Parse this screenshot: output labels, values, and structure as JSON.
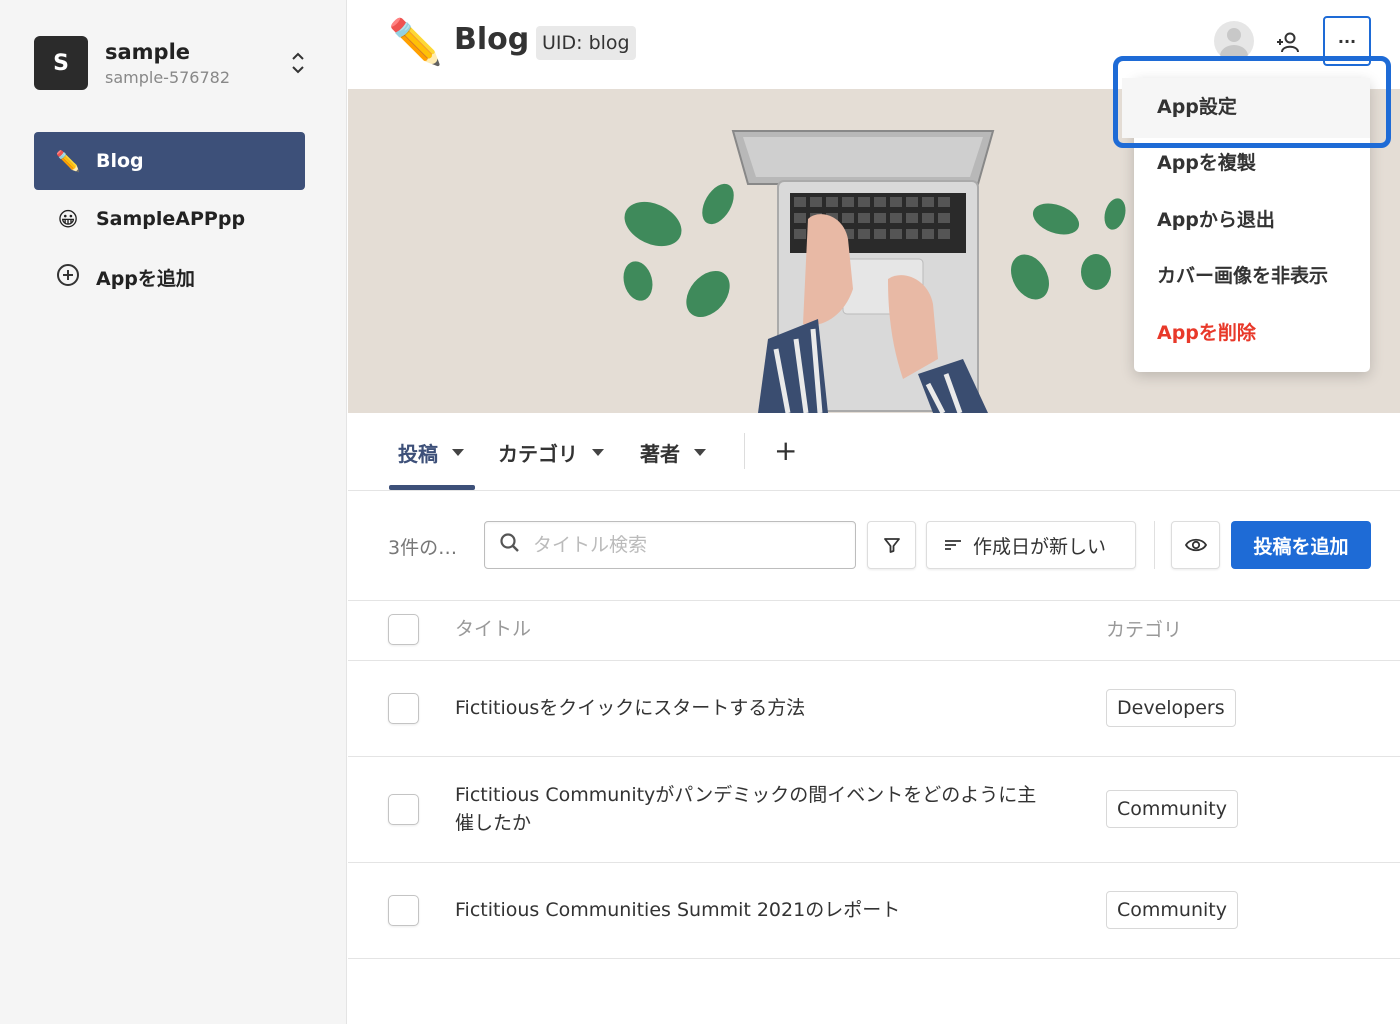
{
  "workspace": {
    "initial": "S",
    "name": "sample",
    "id": "sample-576782"
  },
  "sidebar": {
    "items": [
      {
        "icon": "✏️",
        "label": "Blog",
        "active": true
      },
      {
        "icon": "😀",
        "label": "SampleAPPpp",
        "active": false
      },
      {
        "icon": "plus-circle-icon",
        "label": "Appを追加",
        "active": false
      }
    ]
  },
  "header": {
    "icon": "✏️",
    "title": "Blog",
    "uid": "UID: blog",
    "more": "···"
  },
  "tabs": {
    "items": [
      "投稿",
      "カテゴリ",
      "著者"
    ],
    "add": "+"
  },
  "toolbar": {
    "count": "3件の…",
    "search_placeholder": "タイトル検索",
    "sort_label": "作成日が新しい",
    "add_button": "投稿を追加"
  },
  "table": {
    "headers": {
      "title": "タイトル",
      "category": "カテゴリ"
    },
    "rows": [
      {
        "title": "Fictitiousをクイックにスタートする方法",
        "category": "Developers"
      },
      {
        "title": "Fictitious Communityがパンデミックの間イベントをどのように主催したか",
        "category": "Community"
      },
      {
        "title": "Fictitious Communities Summit 2021のレポート",
        "category": "Community"
      }
    ]
  },
  "menu": {
    "items": [
      "App設定",
      "Appを複製",
      "Appから退出",
      "カバー画像を非表示",
      "Appを削除"
    ]
  },
  "colors": {
    "primary": "#1e6bd6",
    "nav_active": "#3d5079",
    "danger": "#e8392a"
  }
}
